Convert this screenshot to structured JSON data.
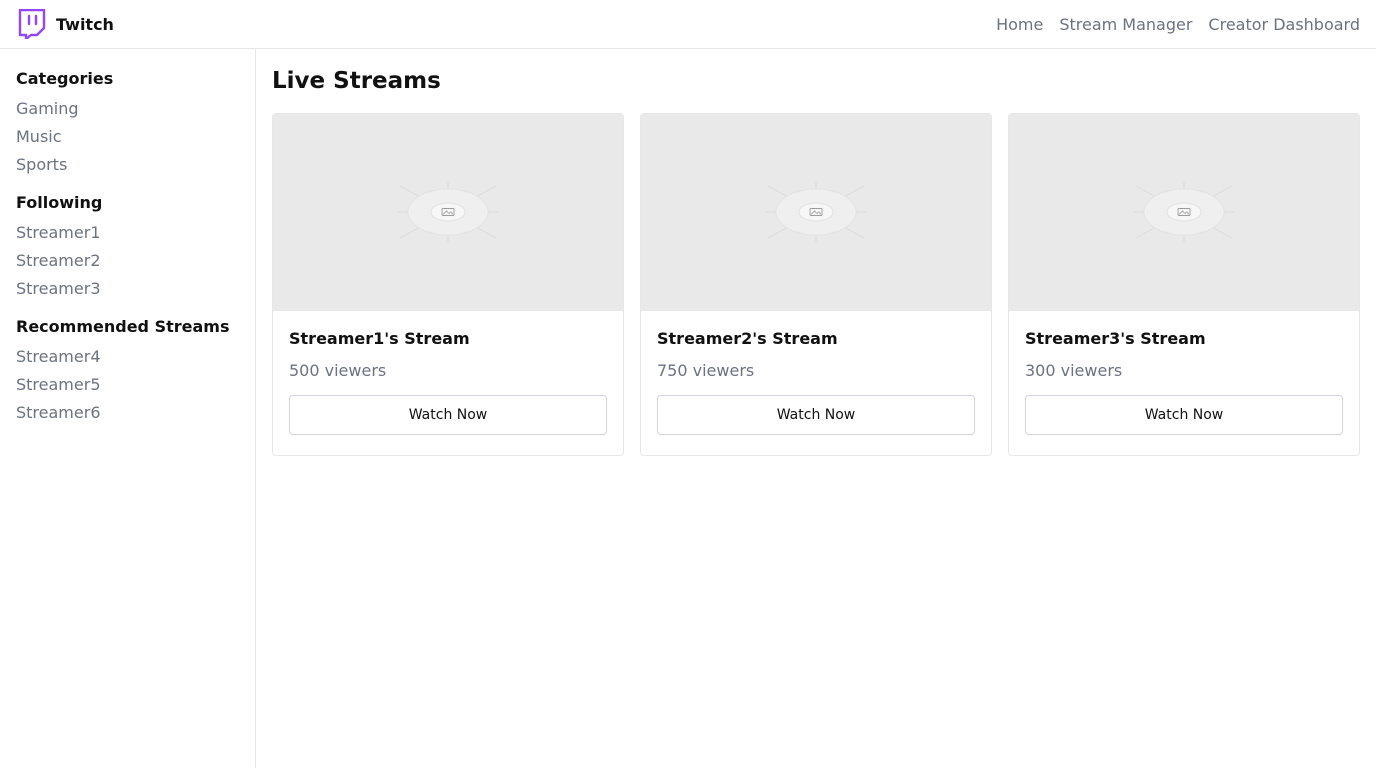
{
  "app": {
    "name": "Twitch",
    "brand_color": "#9146ff"
  },
  "nav": [
    {
      "label": "Home"
    },
    {
      "label": "Stream Manager"
    },
    {
      "label": "Creator Dashboard"
    }
  ],
  "sidebar": {
    "sections": [
      {
        "heading": "Categories",
        "items": [
          "Gaming",
          "Music",
          "Sports"
        ]
      },
      {
        "heading": "Following",
        "items": [
          "Streamer1",
          "Streamer2",
          "Streamer3"
        ]
      },
      {
        "heading": "Recommended Streams",
        "items": [
          "Streamer4",
          "Streamer5",
          "Streamer6"
        ]
      }
    ]
  },
  "main": {
    "title": "Live Streams",
    "streams": [
      {
        "title": "Streamer1's Stream",
        "viewers": "500 viewers",
        "action": "Watch Now",
        "thumbnail_icon": "image-placeholder-icon"
      },
      {
        "title": "Streamer2's Stream",
        "viewers": "750 viewers",
        "action": "Watch Now",
        "thumbnail_icon": "image-placeholder-icon"
      },
      {
        "title": "Streamer3's Stream",
        "viewers": "300 viewers",
        "action": "Watch Now",
        "thumbnail_icon": "image-placeholder-icon"
      }
    ]
  },
  "colors": {
    "muted_text": "#6b7280",
    "border": "#e5e7eb",
    "thumbnail_bg": "#e9e9e9"
  }
}
